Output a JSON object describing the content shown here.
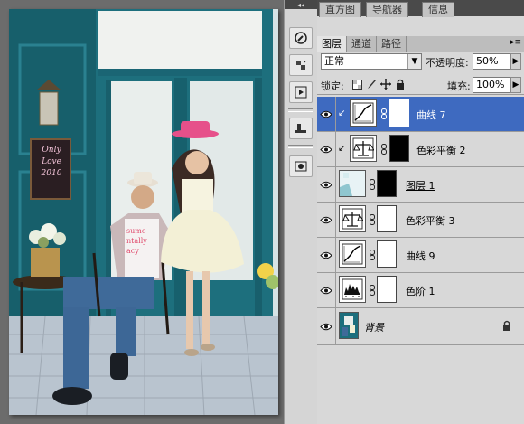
{
  "panel": {
    "top_tabs": [
      "直方图",
      "导航器",
      "信息"
    ],
    "tabs": [
      {
        "label": "图层",
        "active": true
      },
      {
        "label": "通道",
        "active": false
      },
      {
        "label": "路径",
        "active": false
      }
    ],
    "blend_mode": "正常",
    "opacity_label": "不透明度:",
    "opacity_value": "50%",
    "lock_label": "锁定:",
    "fill_label": "填充:",
    "fill_value": "100%"
  },
  "photo": {
    "sign_lines": [
      "Only",
      "Love",
      "2010"
    ],
    "shirt_lines": [
      "sume",
      "ntally",
      "acy"
    ]
  },
  "layers": [
    {
      "name": "曲线 7",
      "type": "curves",
      "selected": true,
      "clipped": true,
      "mask": "white"
    },
    {
      "name": "色彩平衡 2",
      "type": "color-balance",
      "selected": false,
      "clipped": true,
      "mask": "black"
    },
    {
      "name": "图层 1",
      "type": "pixel",
      "selected": false,
      "clipped": false,
      "mask": "black"
    },
    {
      "name": "色彩平衡 3",
      "type": "color-balance",
      "selected": false,
      "clipped": false,
      "mask": "white"
    },
    {
      "name": "曲线 9",
      "type": "curves",
      "selected": false,
      "clipped": false,
      "mask": "white"
    },
    {
      "name": "色阶 1",
      "type": "levels",
      "selected": false,
      "clipped": false,
      "mask": "white"
    },
    {
      "name": "背景",
      "type": "background",
      "selected": false,
      "clipped": false,
      "mask": "none"
    }
  ],
  "colors": {
    "selection": "#3e6ac0",
    "door_teal": "#1d6f7d",
    "hat_pink": "#e6508a"
  }
}
